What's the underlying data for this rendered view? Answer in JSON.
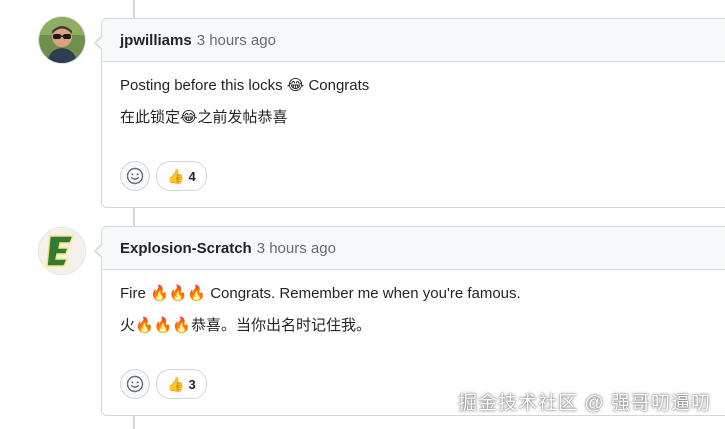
{
  "colors": {
    "border": "#d0d7de",
    "header_bg": "#f6f8fa",
    "muted_text": "#656d76",
    "avatar2_green": "#2e7d32"
  },
  "comments": [
    {
      "author": "jpwilliams",
      "time": "3 hours ago",
      "lines": [
        "Posting before this locks 😂 Congrats",
        "在此锁定😂之前发帖恭喜"
      ],
      "reaction_emoji": "👍",
      "reaction_count": "4",
      "avatar_icon": "person-photo-icon"
    },
    {
      "author": "Explosion-Scratch",
      "time": "3 hours ago",
      "lines": [
        "Fire 🔥🔥🔥 Congrats. Remember me when you're famous.",
        "火🔥🔥🔥恭喜。当你出名时记住我。"
      ],
      "reaction_emoji": "👍",
      "reaction_count": "3",
      "avatar_icon": "letter-e-logo-icon"
    }
  ],
  "watermark": "掘金技术社区 @ 强哥叨逼叨"
}
